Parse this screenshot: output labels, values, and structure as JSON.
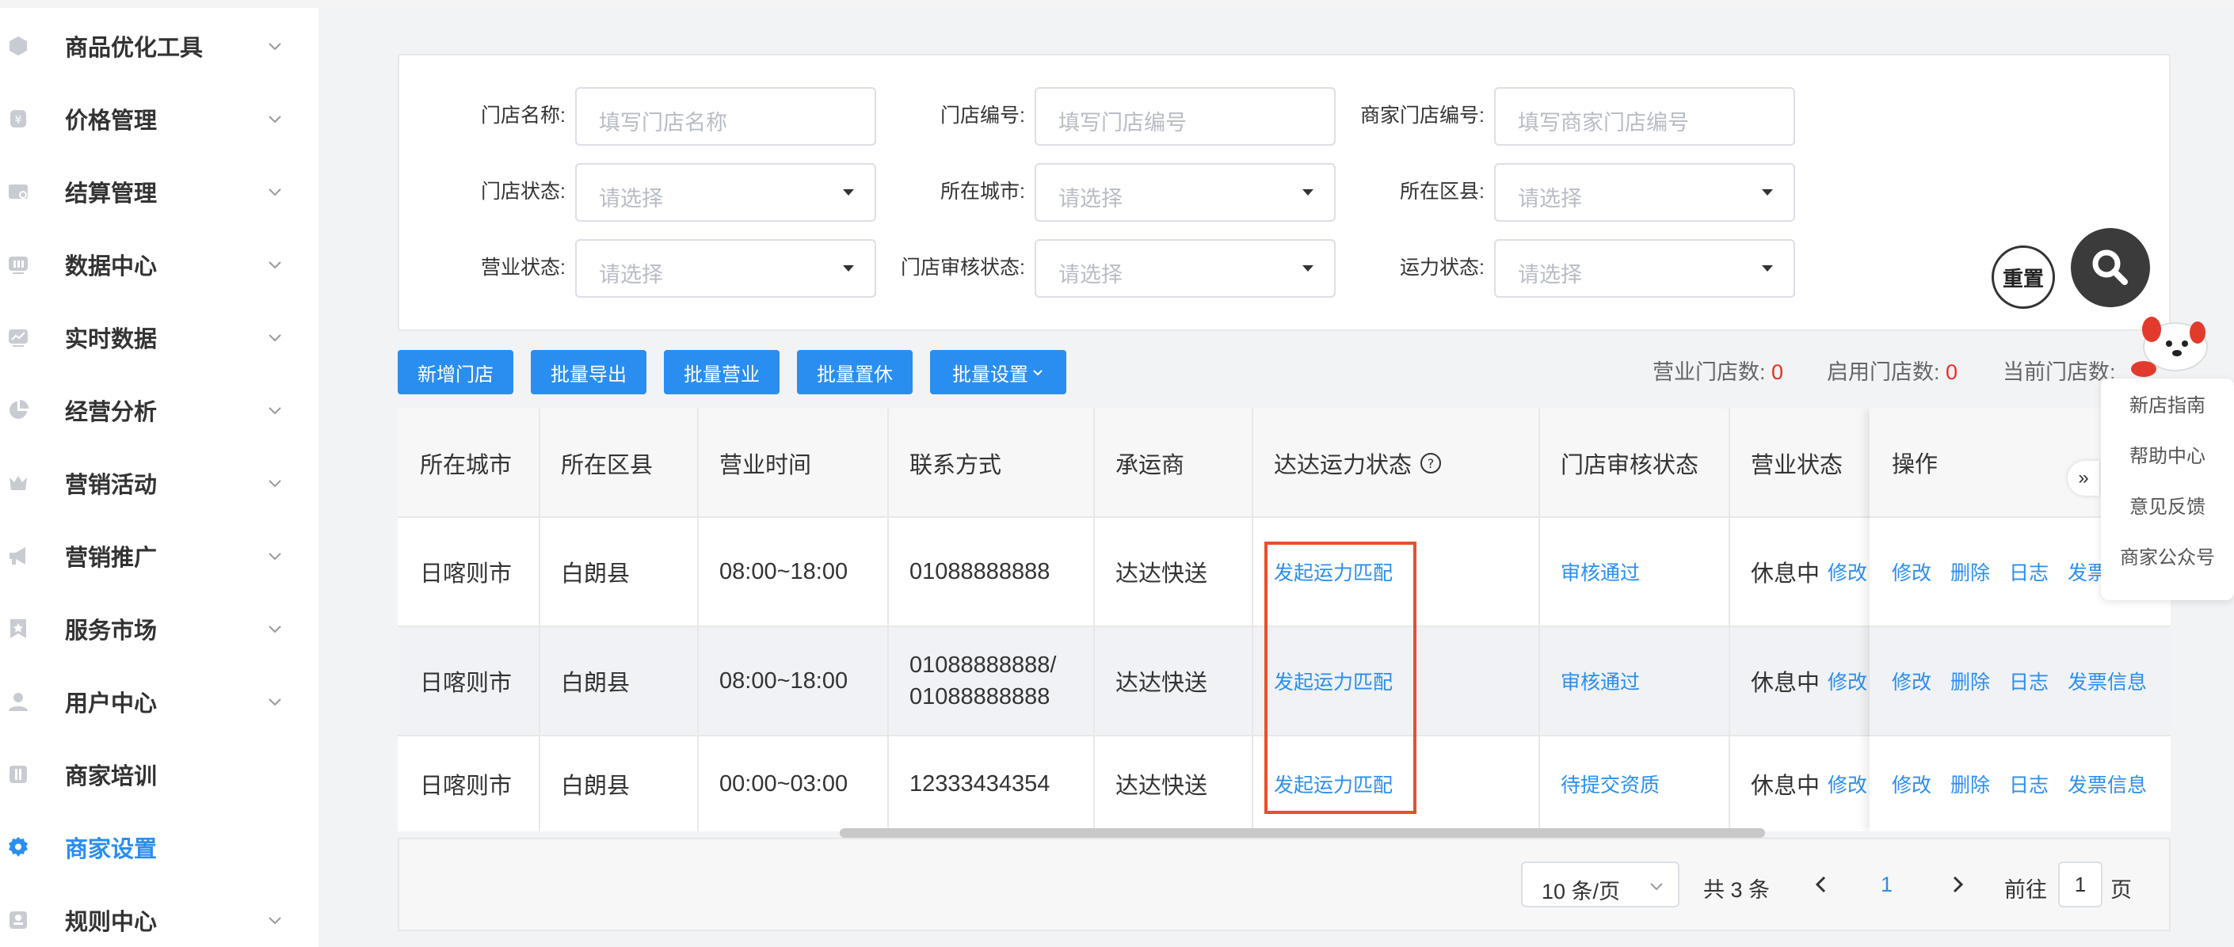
{
  "sidebar": {
    "items": [
      {
        "label": "商品优化工具",
        "icon": "cube-icon"
      },
      {
        "label": "价格管理",
        "icon": "price-icon"
      },
      {
        "label": "结算管理",
        "icon": "settlement-icon"
      },
      {
        "label": "数据中心",
        "icon": "data-icon"
      },
      {
        "label": "实时数据",
        "icon": "trend-icon"
      },
      {
        "label": "经营分析",
        "icon": "pie-icon"
      },
      {
        "label": "营销活动",
        "icon": "crown-icon"
      },
      {
        "label": "营销推广",
        "icon": "megaphone-icon"
      },
      {
        "label": "服务市场",
        "icon": "star-icon"
      },
      {
        "label": "用户中心",
        "icon": "user-icon"
      },
      {
        "label": "商家培训",
        "icon": "book-icon"
      },
      {
        "label": "商家设置",
        "icon": "gear-icon",
        "active": true
      },
      {
        "label": "规则中心",
        "icon": "rule-icon"
      }
    ],
    "active_color": "#2a8ef0"
  },
  "filters": {
    "store_name": {
      "label": "门店名称:",
      "placeholder": "填写门店名称"
    },
    "store_no": {
      "label": "门店编号:",
      "placeholder": "填写门店编号"
    },
    "merchant_store_no": {
      "label": "商家门店编号:",
      "placeholder": "填写商家门店编号"
    },
    "store_status": {
      "label": "门店状态:",
      "placeholder": "请选择"
    },
    "city": {
      "label": "所在城市:",
      "placeholder": "请选择"
    },
    "district": {
      "label": "所在区县:",
      "placeholder": "请选择"
    },
    "business_status": {
      "label": "营业状态:",
      "placeholder": "请选择"
    },
    "audit_status": {
      "label": "门店审核状态:",
      "placeholder": "请选择"
    },
    "capacity_status": {
      "label": "运力状态:",
      "placeholder": "请选择"
    },
    "reset_label": "重置"
  },
  "actions": {
    "add": "新增门店",
    "export": "批量导出",
    "open": "批量营业",
    "close": "批量置休",
    "settings": "批量设置"
  },
  "stats": {
    "open_label": "营业门店数:",
    "open_value": "0",
    "enabled_label": "启用门店数:",
    "enabled_value": "0",
    "current_label": "当前门店数:"
  },
  "table": {
    "headers": [
      "所在城市",
      "所在区县",
      "营业时间",
      "联系方式",
      "承运商",
      "达达运力状态",
      "门店审核状态",
      "营业状态",
      "操作"
    ],
    "rows": [
      {
        "city": "日喀则市",
        "district": "白朗县",
        "hours": "08:00~18:00",
        "contact": "01088888888",
        "contact2": "",
        "carrier": "达达快送",
        "dada": "发起运力匹配",
        "audit": "审核通过",
        "status": "休息中",
        "status_link": "修改",
        "ops": [
          "修改",
          "删除",
          "日志",
          "发票"
        ]
      },
      {
        "city": "日喀则市",
        "district": "白朗县",
        "hours": "08:00~18:00",
        "contact": "01088888888/",
        "contact2": "01088888888",
        "carrier": "达达快送",
        "dada": "发起运力匹配",
        "audit": "审核通过",
        "status": "休息中",
        "status_link": "修改",
        "ops": [
          "修改",
          "删除",
          "日志",
          "发票信息"
        ]
      },
      {
        "city": "日喀则市",
        "district": "白朗县",
        "hours": "00:00~03:00",
        "contact": "12333434354",
        "contact2": "",
        "carrier": "达达快送",
        "dada": "发起运力匹配",
        "audit": "待提交资质",
        "status": "休息中",
        "status_link": "修改",
        "ops": [
          "修改",
          "删除",
          "日志",
          "发票信息"
        ]
      }
    ]
  },
  "pagination": {
    "page_size": "10 条/页",
    "total": "共 3 条",
    "current": "1",
    "goto_label": "前往",
    "goto_value": "1",
    "page_suffix": "页"
  },
  "help": {
    "items": [
      "新店指南",
      "帮助中心",
      "意见反馈",
      "商家公众号"
    ]
  },
  "expand_glyph": "»"
}
